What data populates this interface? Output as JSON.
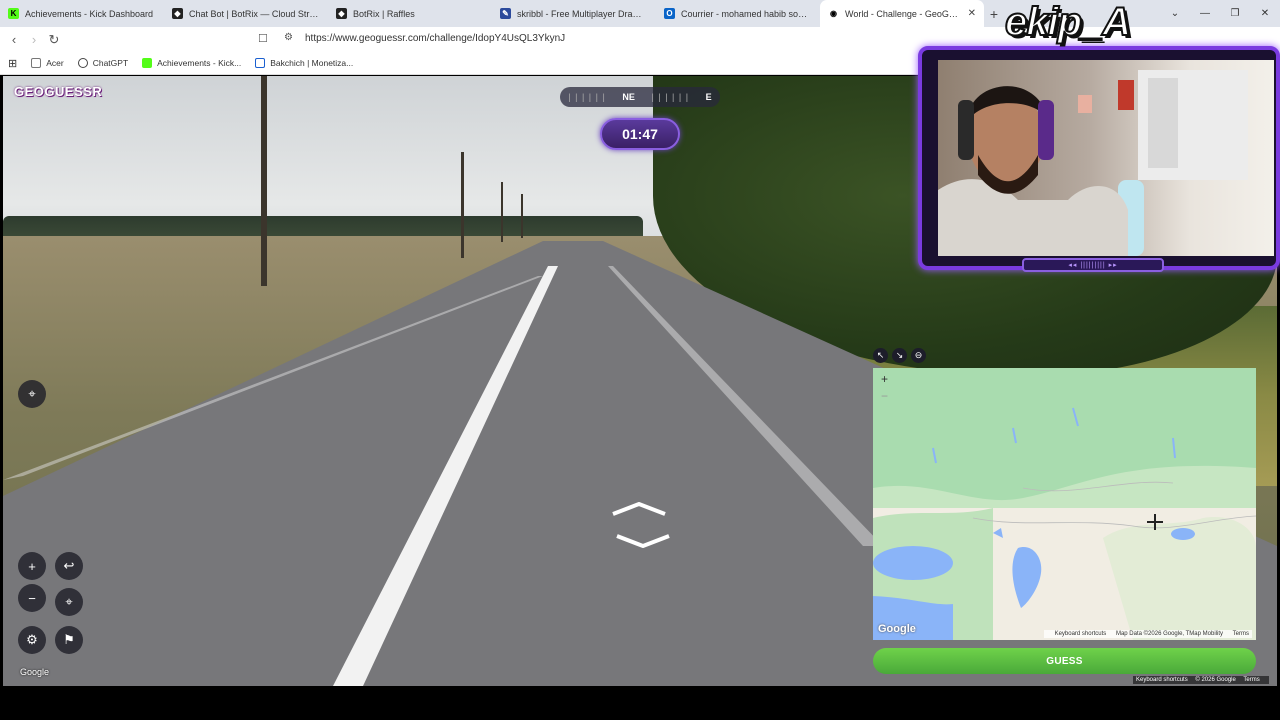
{
  "browser": {
    "tabs": [
      {
        "title": "Achievements - Kick Dashboard",
        "icon": "kick-icon",
        "color": "#53fc18",
        "glyph": "K"
      },
      {
        "title": "Chat Bot | BotRix — Cloud Streaming",
        "icon": "botrix-icon",
        "color": "#222222",
        "glyph": "◆"
      },
      {
        "title": "BotRix | Raffles",
        "icon": "botrix-icon",
        "color": "#222222",
        "glyph": "◆"
      },
      {
        "title": "skribbl - Free Multiplayer Drawing &",
        "icon": "skribbl-icon",
        "color": "#2c4a9c",
        "glyph": "✎"
      },
      {
        "title": "Courrier - mohamed habib souaied",
        "icon": "outlook-icon",
        "color": "#0a64c8",
        "glyph": "O"
      },
      {
        "title": "World - Challenge - GeoGuessr",
        "icon": "geoguessr-icon",
        "color": "#ffffff",
        "glyph": "◉",
        "active": true
      }
    ],
    "new_tab": "+",
    "url": "https://www.geoguessr.com/challenge/IdopY4UsQL3YkynJ",
    "bookmarks": [
      {
        "label": "Acer",
        "icon": "folder-icon"
      },
      {
        "label": "ChatGPT",
        "icon": "chatgpt-icon"
      },
      {
        "label": "Achievements - Kick...",
        "icon": "kick-icon"
      },
      {
        "label": "Bakchich | Monetiza...",
        "icon": "bakchich-icon"
      }
    ]
  },
  "game": {
    "logo": "GEOGUESSR",
    "compass": {
      "heading": "NE",
      "east": "E"
    },
    "timer": "01:47",
    "google_watermark": "Google"
  },
  "map": {
    "zoom_in": "+",
    "zoom_out": "−",
    "google_logo": "Google",
    "attribution": {
      "shortcuts": "Keyboard shortcuts",
      "data": "Map Data ©2026 Google, TMap Mobility",
      "terms": "Terms"
    },
    "guess_button": "GUESS"
  },
  "footer_attribution": {
    "shortcuts": "Keyboard shortcuts",
    "copyright": "© 2026 Google",
    "terms": "Terms"
  },
  "overlay": {
    "title": "ekip_A",
    "frame_color": "#7a3be0"
  },
  "colors": {
    "accent_purple": "#8a5fe0",
    "guess_green": "#6fd24a"
  }
}
